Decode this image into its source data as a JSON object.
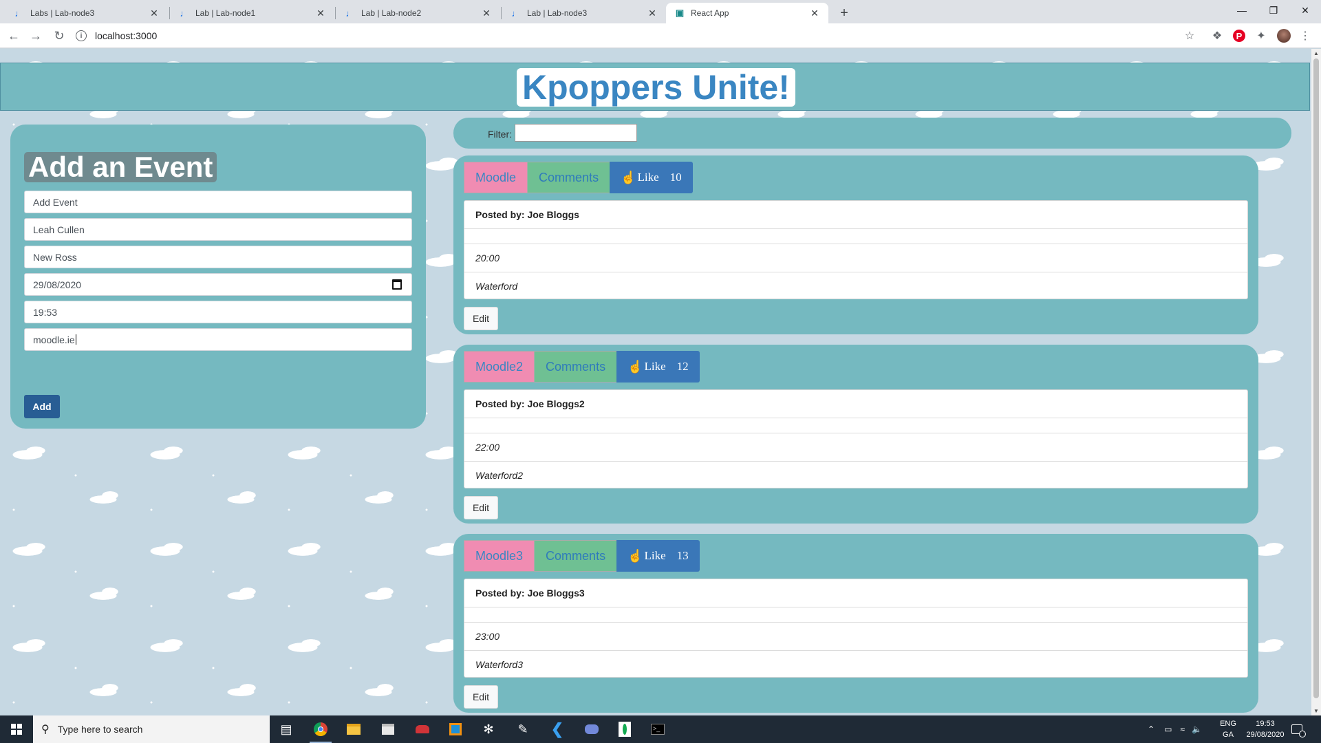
{
  "browser": {
    "tabs": [
      {
        "title": "Labs | Lab-node3",
        "active": false
      },
      {
        "title": "Lab | Lab-node1",
        "active": false
      },
      {
        "title": "Lab | Lab-node2",
        "active": false
      },
      {
        "title": "Lab | Lab-node3",
        "active": false
      },
      {
        "title": "React App",
        "active": true
      }
    ],
    "url": "localhost:3000"
  },
  "app": {
    "title": "Kpoppers Unite!",
    "colors": {
      "header": "#75b9c0",
      "title": "#3a86c2",
      "name_button": "#f08cb2",
      "comments_button": "#6fc093",
      "like_button": "#3a77b8",
      "add_button": "#285d94"
    }
  },
  "add_form": {
    "heading": "Add an Event",
    "fields": {
      "event": {
        "value": "",
        "placeholder": "Add Event"
      },
      "author": {
        "value": "Leah Cullen"
      },
      "location": {
        "value": "New Ross"
      },
      "date": {
        "value": "29/08/2020"
      },
      "time": {
        "value": "19:53"
      },
      "link": {
        "value": "moodle.ie"
      }
    },
    "add_label": "Add"
  },
  "filter": {
    "label": "Filter:",
    "value": ""
  },
  "events": [
    {
      "name": "Moodle",
      "comments_label": "Comments",
      "like_label": "Like",
      "likes": "10",
      "posted_by": "Posted by: Joe Bloggs",
      "time": "20:00",
      "location": "Waterford",
      "edit_label": "Edit"
    },
    {
      "name": "Moodle2",
      "comments_label": "Comments",
      "like_label": "Like",
      "likes": "12",
      "posted_by": "Posted by: Joe Bloggs2",
      "time": "22:00",
      "location": "Waterford2",
      "edit_label": "Edit"
    },
    {
      "name": "Moodle3",
      "comments_label": "Comments",
      "like_label": "Like",
      "likes": "13",
      "posted_by": "Posted by: Joe Bloggs3",
      "time": "23:00",
      "location": "Waterford3",
      "edit_label": "Edit"
    }
  ],
  "taskbar": {
    "search_placeholder": "Type here to search",
    "language": "ENG",
    "keyboard": "GA",
    "time": "19:53",
    "date": "29/08/2020",
    "notification_count": "1",
    "apps": [
      "task-view-icon",
      "chrome-icon",
      "file-explorer-icon",
      "store-icon",
      "red-app-icon",
      "orange-app-icon",
      "steam-icon",
      "paint-icon",
      "vscode-icon",
      "discord-icon",
      "mongodb-icon",
      "terminal-icon"
    ]
  }
}
